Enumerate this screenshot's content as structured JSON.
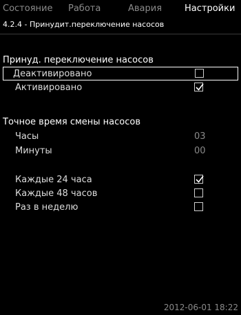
{
  "tabs": [
    {
      "label": "Состояние"
    },
    {
      "label": "Работа"
    },
    {
      "label": "Авария"
    },
    {
      "label": "Настройки"
    }
  ],
  "menu_path": "4.2.4 - Принудит.переключение насосов",
  "section1": {
    "title": "Принуд. переключение насосов",
    "options": [
      {
        "label": "Деактивировано",
        "checked": false
      },
      {
        "label": "Активировано",
        "checked": true
      }
    ]
  },
  "section2": {
    "title": "Точное время смены насосов",
    "hours_label": "Часы",
    "hours_value": "03",
    "minutes_label": "Минуты",
    "minutes_value": "00"
  },
  "intervals": [
    {
      "label": "Каждые 24 часа",
      "checked": true
    },
    {
      "label": "Каждые 48 часов",
      "checked": false
    },
    {
      "label": "Раз в неделю",
      "checked": false
    }
  ],
  "timestamp": "2012-06-01 18:22",
  "colors": {
    "active_tab": "#ffffff",
    "inactive": "#8a8a8a",
    "background": "#000000"
  }
}
